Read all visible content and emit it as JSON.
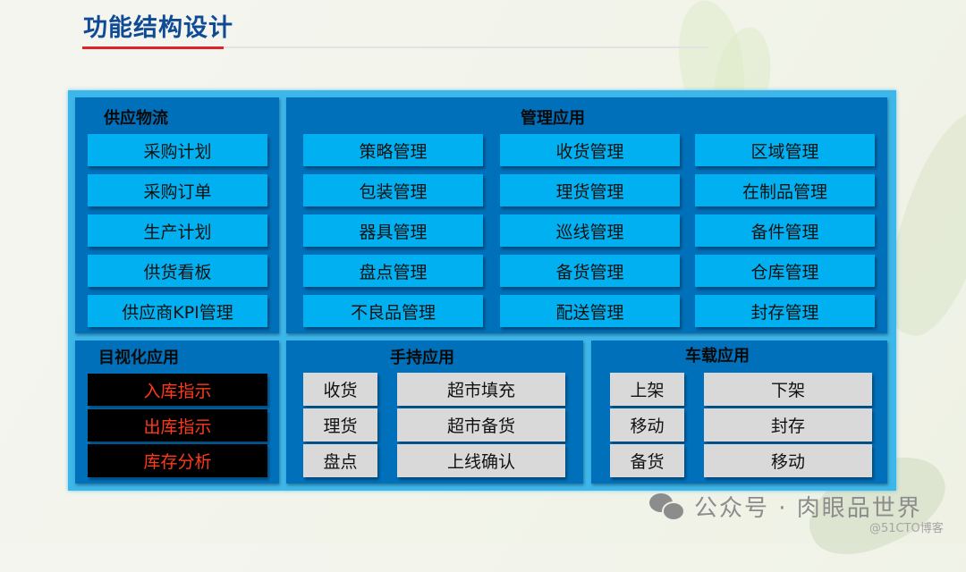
{
  "page": {
    "title": "功能结构设计"
  },
  "colors": {
    "accent_red": "#e0222b",
    "title_blue": "#0f4a95",
    "panel_blue": "#0070bb",
    "frame_blue": "#3db6ea",
    "item_cyan": "#00b0f0",
    "item_gray": "#d9d9d9",
    "alert_text": "#ff3a1a"
  },
  "supply": {
    "title": "供应物流",
    "items": [
      "采购计划",
      "采购订单",
      "生产计划",
      "供货看板",
      "供应商KPI管理"
    ]
  },
  "management": {
    "title": "管理应用",
    "columns": [
      [
        "策略管理",
        "包装管理",
        "器具管理",
        "盘点管理",
        "不良品管理"
      ],
      [
        "收货管理",
        "理货管理",
        "巡线管理",
        "备货管理",
        "配送管理"
      ],
      [
        "区域管理",
        "在制品管理",
        "备件管理",
        "仓库管理",
        "封存管理"
      ]
    ]
  },
  "visual": {
    "title": "目视化应用",
    "items": [
      "入库指示",
      "出库指示",
      "库存分析"
    ]
  },
  "handheld": {
    "title": "手持应用",
    "left": [
      "收货",
      "理货",
      "盘点"
    ],
    "right": [
      "超市填充",
      "超市备货",
      "上线确认"
    ]
  },
  "vehicle": {
    "title": "车载应用",
    "left": [
      "上架",
      "移动",
      "备货"
    ],
    "right": [
      "下架",
      "封存",
      "移动"
    ]
  },
  "watermark": {
    "text": "公众号 · 肉眼品世界",
    "source": "@51CTO博客",
    "icon": "wechat-icon"
  }
}
